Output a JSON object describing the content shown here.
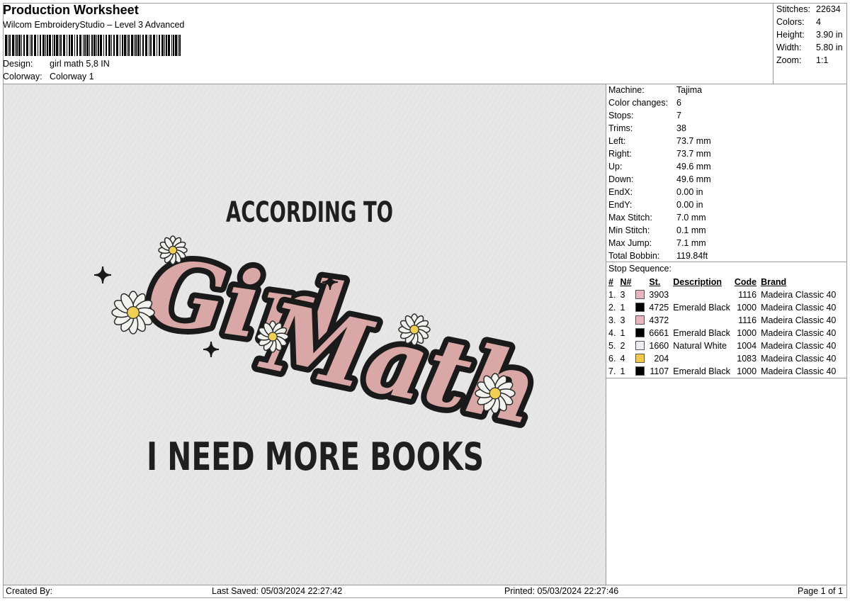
{
  "header": {
    "title": "Production Worksheet",
    "software": "Wilcom EmbroideryStudio – Level 3 Advanced",
    "design_label": "Design:",
    "design_value": "girl math 5,8 IN",
    "colorway_label": "Colorway:",
    "colorway_value": "Colorway 1"
  },
  "summary": [
    {
      "label": "Stitches:",
      "value": "22634"
    },
    {
      "label": "Colors:",
      "value": "4"
    },
    {
      "label": "Height:",
      "value": "3.90 in"
    },
    {
      "label": "Width:",
      "value": "5.80 in"
    },
    {
      "label": "Zoom:",
      "value": "1:1"
    }
  ],
  "specs": [
    {
      "label": "Machine:",
      "value": "Tajima"
    },
    {
      "label": "Color changes:",
      "value": "6"
    },
    {
      "label": "Stops:",
      "value": "7"
    },
    {
      "label": "Trims:",
      "value": "38"
    },
    {
      "label": "Left:",
      "value": "73.7 mm"
    },
    {
      "label": "Right:",
      "value": "73.7 mm"
    },
    {
      "label": "Up:",
      "value": "49.6 mm"
    },
    {
      "label": "Down:",
      "value": "49.6 mm"
    },
    {
      "label": "EndX:",
      "value": "0.00 in"
    },
    {
      "label": "EndY:",
      "value": "0.00 in"
    },
    {
      "label": "Max Stitch:",
      "value": "7.0 mm"
    },
    {
      "label": "Min Stitch:",
      "value": "0.1 mm"
    },
    {
      "label": "Max Jump:",
      "value": "7.1 mm"
    },
    {
      "label": "Total Bobbin:",
      "value": "119.84ft"
    }
  ],
  "stop_sequence": {
    "title": "Stop Sequence:",
    "headers": {
      "num": "#",
      "n": "N#",
      "st": "St.",
      "desc": "Description",
      "code": "Code",
      "brand": "Brand"
    },
    "rows": [
      {
        "num": "1.",
        "n": "3",
        "color": "#e8b4bd",
        "st": "3903",
        "desc": "",
        "code": "1116",
        "brand": "Madeira Classic 40"
      },
      {
        "num": "2.",
        "n": "1",
        "color": "#000000",
        "st": "4725",
        "desc": "Emerald Black",
        "code": "1000",
        "brand": "Madeira Classic 40"
      },
      {
        "num": "3.",
        "n": "3",
        "color": "#e8b4bd",
        "st": "4372",
        "desc": "",
        "code": "1116",
        "brand": "Madeira Classic 40"
      },
      {
        "num": "4.",
        "n": "1",
        "color": "#000000",
        "st": "6661",
        "desc": "Emerald Black",
        "code": "1000",
        "brand": "Madeira Classic 40"
      },
      {
        "num": "5.",
        "n": "2",
        "color": "#eeeef2",
        "st": "1660",
        "desc": "Natural White",
        "code": "1004",
        "brand": "Madeira Classic 40"
      },
      {
        "num": "6.",
        "n": "4",
        "color": "#f2c94c",
        "st": "204",
        "desc": "",
        "code": "1083",
        "brand": "Madeira Classic 40"
      },
      {
        "num": "7.",
        "n": "1",
        "color": "#000000",
        "st": "1107",
        "desc": "Emerald Black",
        "code": "1000",
        "brand": "Madeira Classic 40"
      }
    ]
  },
  "footer": {
    "created_by": "Created By:",
    "last_saved": "Last Saved: 05/03/2024 22:27:42",
    "printed": "Printed: 05/03/2024 22:27:46",
    "page": "Page 1 of 1"
  },
  "design": {
    "line1": "ACCORDING TO",
    "line2a": "Girl",
    "line2b": "Math",
    "line3": "I NEED MORE BOOKS",
    "colors": {
      "fabric": "#e6e6e6",
      "pink": "#d9a8a6",
      "black": "#1a1a1a",
      "petal": "#f2f2ee",
      "center": "#f0cf55"
    }
  }
}
